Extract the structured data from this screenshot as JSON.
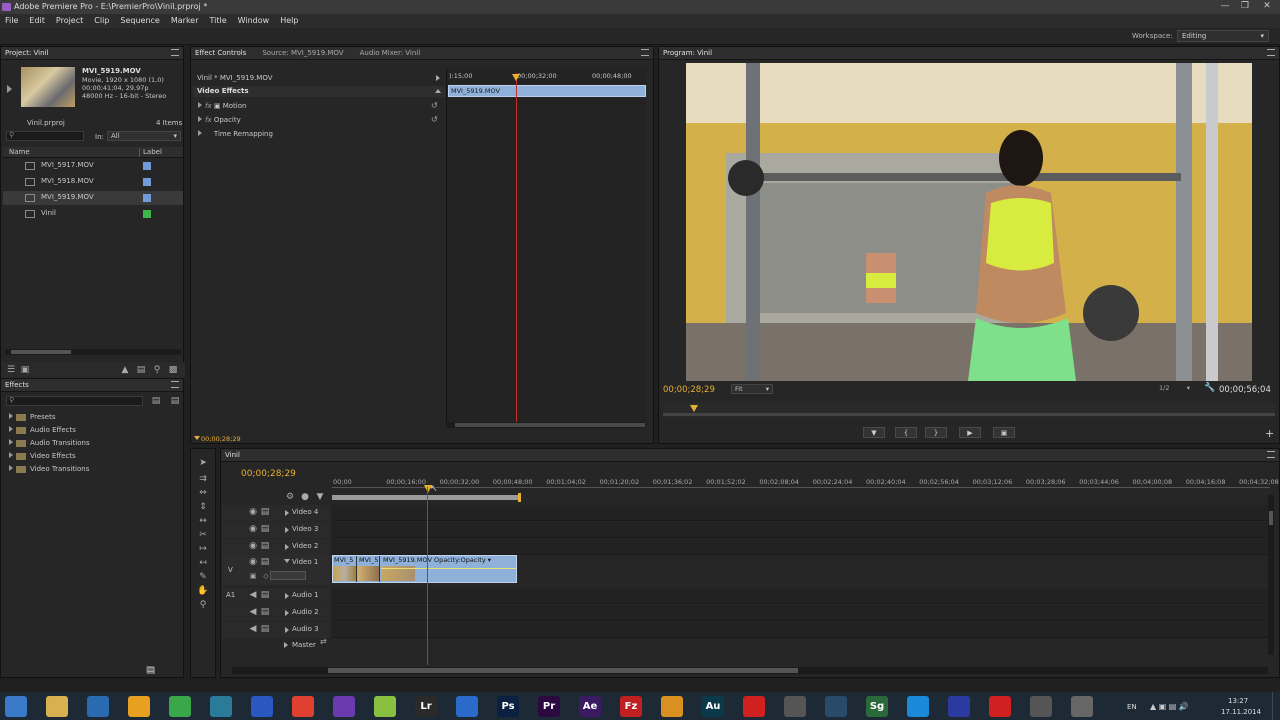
{
  "window": {
    "title": "Adobe Premiere Pro - E:\\PremierPro\\Vinil.prproj *"
  },
  "menu": [
    "File",
    "Edit",
    "Project",
    "Clip",
    "Sequence",
    "Marker",
    "Title",
    "Window",
    "Help"
  ],
  "workspace": {
    "label": "Workspace:",
    "value": "Editing"
  },
  "project": {
    "tab": "Project: Vinil",
    "clip_name": "MVI_5919.MOV",
    "clip_info": [
      "Movie, 1920 x 1080 (1,0)",
      "00;00;41;04, 29,97p",
      "48000 Hz - 16-bit - Stereo"
    ],
    "project_file": "Vinil.prproj",
    "item_count": "4 Items",
    "in_label": "In:",
    "in_value": "All",
    "col_name": "Name",
    "col_label": "Label",
    "items": [
      {
        "name": "MVI_5917.MOV",
        "color": "#6f9bd9"
      },
      {
        "name": "MVI_5918.MOV",
        "color": "#6f9bd9"
      },
      {
        "name": "MVI_5919.MOV",
        "color": "#6f9bd9"
      },
      {
        "name": "Vinil",
        "color": "#3ab84a"
      }
    ]
  },
  "effects": {
    "tab": "Effects",
    "items": [
      "Presets",
      "Audio Effects",
      "Audio Transitions",
      "Video Effects",
      "Video Transitions"
    ]
  },
  "effect_controls": {
    "tabs": [
      "Effect Controls",
      "Source: MVI_5919.MOV",
      "Audio Mixer: Vinil"
    ],
    "clip_path": "Vinil * MVI_5919.MOV",
    "section": "Video Effects",
    "effects": [
      "Motion",
      "Opacity",
      "Time Remapping"
    ],
    "ruler": [
      "):15;00",
      "00;00;32;00",
      "00;00;48;00"
    ],
    "clip_bar": "MVI_5919.MOV",
    "timecode": "00;00;28;29"
  },
  "program": {
    "tab": "Program: Vinil",
    "timecode": "00;00;28;29",
    "fit": "Fit",
    "quality": "1/2",
    "duration": "00;00;56;04"
  },
  "timeline": {
    "tab": "Vinil",
    "timecode": "00;00;28;29",
    "ruler": [
      "00;00",
      "00;00;16;00",
      "00;00;32;00",
      "00;00;48;00",
      "00;01;04;02",
      "00;01;20;02",
      "00;01;36;02",
      "00;01;52;02",
      "00;02;08;04",
      "00;02;24;04",
      "00;02;40;04",
      "00;02;56;04",
      "00;03;12;06",
      "00;03;28;06",
      "00;03;44;06",
      "00;04;00;08",
      "00;04;16;08",
      "00;04;32;08"
    ],
    "video_tracks": [
      "Video 4",
      "Video 3",
      "Video 2",
      "Video 1"
    ],
    "audio_tracks": [
      "Audio 1",
      "Audio 2",
      "Audio 3"
    ],
    "master": "Master",
    "v_label": "V",
    "a_label": "A1",
    "clips": [
      {
        "label": "MVI_5"
      },
      {
        "label": "MVI_5"
      },
      {
        "label": "MVI_5919.MOV  Opacity:Opacity ▾"
      }
    ]
  },
  "taskbar": {
    "lang": "EN",
    "time": "13:27",
    "date": "17.11.2014",
    "apps": [
      "start",
      "explorer",
      "notepad",
      "app",
      "torrent",
      "tool",
      "ie",
      "chrome",
      "vs",
      "green",
      "Lr",
      "globe",
      "Ps",
      "Pr",
      "Ae",
      "Fz",
      "app2",
      "Au",
      "yandex",
      "app3",
      "app4",
      "Sg",
      "skype",
      "app5",
      "yandex2",
      "app6",
      "app7"
    ]
  }
}
